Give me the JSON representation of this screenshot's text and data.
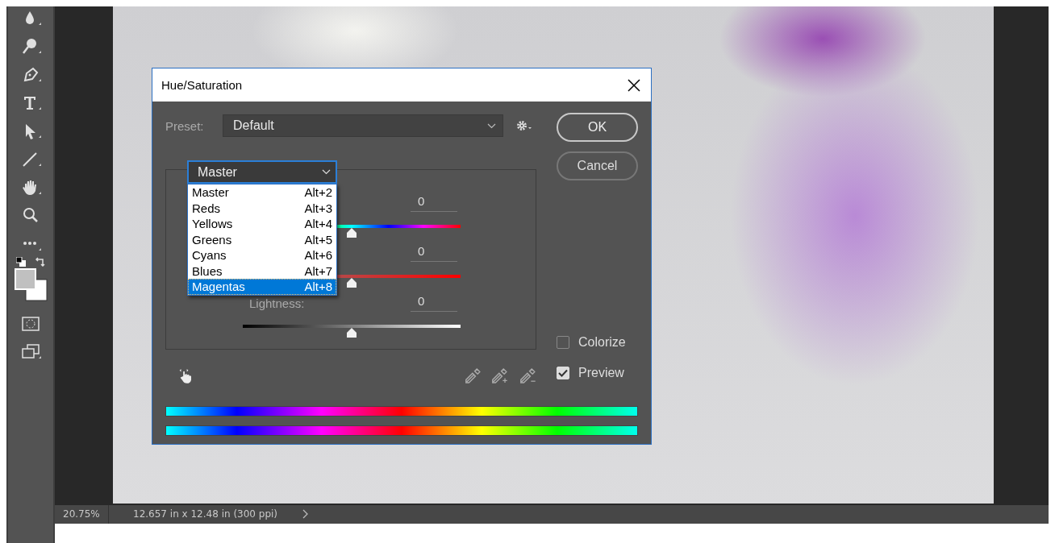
{
  "dialog": {
    "title": "Hue/Saturation",
    "preset": {
      "label": "Preset:",
      "value": "Default"
    },
    "buttons": [
      "OK",
      "Cancel"
    ],
    "channel": {
      "value": "Master",
      "options": [
        {
          "label": "Master",
          "shortcut": "Alt+2",
          "highlighted": false
        },
        {
          "label": "Reds",
          "shortcut": "Alt+3",
          "highlighted": false
        },
        {
          "label": "Yellows",
          "shortcut": "Alt+4",
          "highlighted": false
        },
        {
          "label": "Greens",
          "shortcut": "Alt+5",
          "highlighted": false
        },
        {
          "label": "Cyans",
          "shortcut": "Alt+6",
          "highlighted": false
        },
        {
          "label": "Blues",
          "shortcut": "Alt+7",
          "highlighted": false
        },
        {
          "label": "Magentas",
          "shortcut": "Alt+8",
          "highlighted": true
        }
      ]
    },
    "sliders": [
      {
        "kind": "hue",
        "value": "0",
        "level": 0.5
      },
      {
        "kind": "saturation",
        "value": "0",
        "level": 0.5
      },
      {
        "kind": "lightness",
        "label": "Lightness:",
        "value": "0",
        "level": 0.5
      }
    ],
    "checkboxes": [
      {
        "label": "Colorize",
        "checked": false
      },
      {
        "label": "Preview",
        "checked": true
      }
    ]
  },
  "status_bar": {
    "zoom": "20.75%",
    "document_info": "12.657 in x 12.48 in (300 ppi)"
  }
}
